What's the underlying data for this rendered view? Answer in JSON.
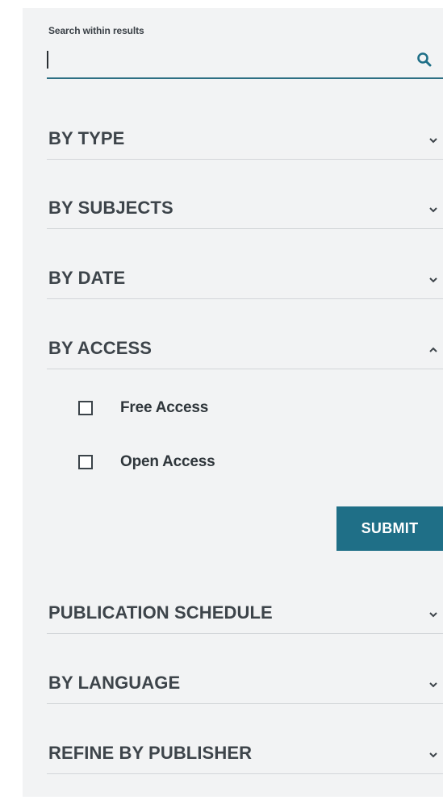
{
  "search": {
    "label": "Search within results",
    "value": "",
    "placeholder": ""
  },
  "facets": [
    {
      "label": "BY TYPE",
      "expanded": false
    },
    {
      "label": "BY SUBJECTS",
      "expanded": false
    },
    {
      "label": "BY DATE",
      "expanded": false
    },
    {
      "label": "BY ACCESS",
      "expanded": true
    },
    {
      "label": "PUBLICATION SCHEDULE",
      "expanded": false
    },
    {
      "label": "BY LANGUAGE",
      "expanded": false
    },
    {
      "label": "REFINE BY PUBLISHER",
      "expanded": false
    }
  ],
  "access_options": [
    {
      "label": "Free Access",
      "checked": false
    },
    {
      "label": "Open Access",
      "checked": false
    }
  ],
  "submit_label": "SUBMIT",
  "colors": {
    "panel_background": "#f2f3f4",
    "accent": "#1f6f87",
    "text": "#3d444a"
  },
  "icons": {
    "search": "search-icon",
    "collapsed": "chevron-down-icon",
    "expanded": "chevron-up-icon"
  }
}
